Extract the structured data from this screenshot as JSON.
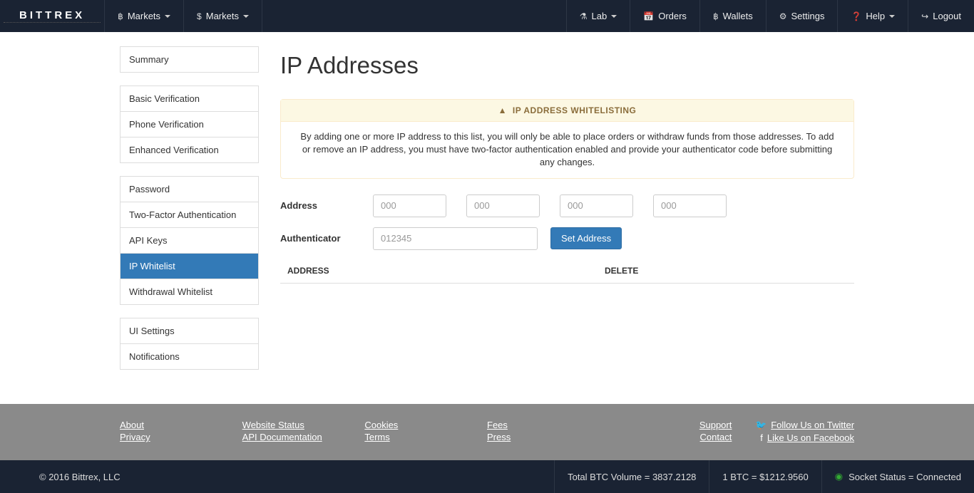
{
  "brand": "BITTREX",
  "nav": {
    "left": [
      {
        "icon": "฿",
        "label": "Markets",
        "caret": true
      },
      {
        "icon": "$",
        "label": "Markets",
        "caret": true
      }
    ],
    "right": [
      {
        "icon": "⚗",
        "label": "Lab",
        "caret": true,
        "name": "nav-lab"
      },
      {
        "icon": "📅",
        "label": "Orders",
        "name": "nav-orders"
      },
      {
        "icon": "฿",
        "label": "Wallets",
        "name": "nav-wallets"
      },
      {
        "icon": "⚙",
        "label": "Settings",
        "name": "nav-settings"
      },
      {
        "icon": "❓",
        "label": "Help",
        "caret": true,
        "name": "nav-help"
      },
      {
        "icon": "↪",
        "label": "Logout",
        "name": "nav-logout"
      }
    ]
  },
  "sidebar": {
    "groups": [
      {
        "items": [
          {
            "label": "Summary",
            "name": "summary"
          }
        ]
      },
      {
        "items": [
          {
            "label": "Basic Verification",
            "name": "basic-verification"
          },
          {
            "label": "Phone Verification",
            "name": "phone-verification"
          },
          {
            "label": "Enhanced Verification",
            "name": "enhanced-verification"
          }
        ]
      },
      {
        "items": [
          {
            "label": "Password",
            "name": "password"
          },
          {
            "label": "Two-Factor Authentication",
            "name": "two-factor"
          },
          {
            "label": "API Keys",
            "name": "api-keys"
          },
          {
            "label": "IP Whitelist",
            "name": "ip-whitelist",
            "active": true
          },
          {
            "label": "Withdrawal Whitelist",
            "name": "withdrawal-whitelist"
          }
        ]
      },
      {
        "items": [
          {
            "label": "UI Settings",
            "name": "ui-settings"
          },
          {
            "label": "Notifications",
            "name": "notifications"
          }
        ]
      }
    ]
  },
  "page": {
    "title": "IP Addresses",
    "panel_title": "IP ADDRESS WHITELISTING",
    "panel_body": "By adding one or more IP address to this list, you will only be able to place orders or withdraw funds from those addresses. To add or remove an IP address, you must have two-factor authentication enabled and provide your authenticator code before submitting any changes."
  },
  "form": {
    "address_label": "Address",
    "auth_label": "Authenticator",
    "octet_placeholder": "000",
    "auth_placeholder": "012345",
    "submit_label": "Set Address"
  },
  "table": {
    "col_address": "ADDRESS",
    "col_delete": "DELETE"
  },
  "footer": {
    "col1": {
      "a": "About",
      "b": "Privacy"
    },
    "col2": {
      "a": "Website Status",
      "b": "API Documentation"
    },
    "col3": {
      "a": "Cookies",
      "b": "Terms"
    },
    "col4": {
      "a": "Fees",
      "b": "Press"
    },
    "col5": {
      "a": "Support",
      "b": "Contact"
    },
    "col6": {
      "a": "Follow Us on Twitter",
      "b": "Like Us on Facebook"
    }
  },
  "status": {
    "copyright": "© 2016 Bittrex, LLC",
    "volume": "Total BTC Volume = 3837.2128",
    "price": "1 BTC = $1212.9560",
    "socket": "Socket Status = Connected"
  }
}
